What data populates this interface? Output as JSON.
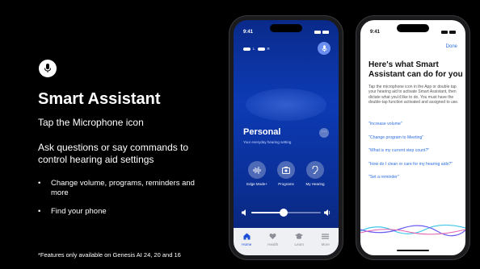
{
  "slide": {
    "title": "Smart Assistant",
    "subtitle": "Tap the Microphone icon",
    "description": "Ask questions or say commands to control hearing aid settings",
    "bullets": [
      "Change volume, programs, reminders and more",
      "Find your phone"
    ],
    "footnote": "*Features only available on Genesis AI 24, 20 and 16"
  },
  "phone1": {
    "time": "9:41",
    "left_label": "L",
    "right_label": "R",
    "program_name": "Personal",
    "program_subtitle": "Your everyday hearing setting",
    "quick_actions": [
      "Edge Mode+",
      "Programs",
      "My Hearing"
    ],
    "volume_level": 0.52,
    "tabs": [
      "Home",
      "Health",
      "Learn",
      "More"
    ],
    "active_tab": "Home",
    "accent": "#1e4fd8"
  },
  "phone2": {
    "time": "9:41",
    "done_label": "Done",
    "heading": "Here's what Smart Assistant can do for you",
    "body": "Tap the microphone icon in the App or double tap your hearing aid to activate Smart Assistant, then dictate what you'd like to do. You must have the double-tap function activated and assigned to use.",
    "examples": [
      "\"Increase volume\"",
      "\"Change program to Meeting\"",
      "\"What is my current step count?\"",
      "\"How do I clean or care for my hearing aids?\"",
      "\"Set a reminder\""
    ],
    "link_color": "#2a6de0"
  }
}
